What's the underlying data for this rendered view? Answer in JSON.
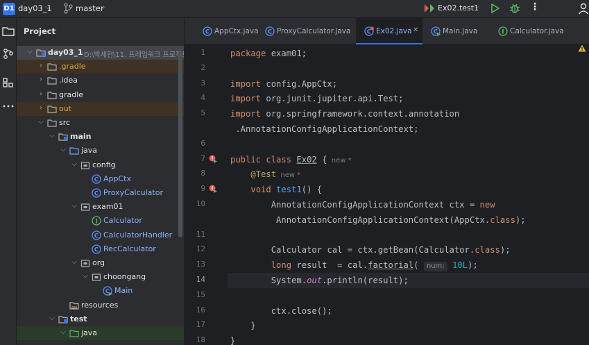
{
  "titlebar": {
    "project_badge": "D1",
    "project_name": "day03_1",
    "branch": "master",
    "run_config": "Ex02.test1",
    "more": "⋮"
  },
  "project_panel": {
    "title": "Project",
    "tree": [
      {
        "label": "day03_1",
        "extra": "D:\\박세현\\11. 프레임워크 프로젝트",
        "level": 0,
        "expanded": true,
        "icon": "module-folder-icon",
        "bold": true,
        "style": "sel"
      },
      {
        "label": ".gradle",
        "level": 1,
        "expanded": false,
        "icon": "folder-icon",
        "color": "orange",
        "style": "excl"
      },
      {
        "label": ".idea",
        "level": 1,
        "expanded": false,
        "icon": "folder-icon"
      },
      {
        "label": "gradle",
        "level": 1,
        "expanded": false,
        "icon": "folder-icon"
      },
      {
        "label": "out",
        "level": 1,
        "expanded": false,
        "icon": "folder-icon",
        "color": "orange",
        "style": "excl"
      },
      {
        "label": "src",
        "level": 1,
        "expanded": true,
        "icon": "folder-icon"
      },
      {
        "label": "main",
        "level": 2,
        "expanded": true,
        "icon": "module-folder-icon",
        "bold": true
      },
      {
        "label": "java",
        "level": 3,
        "expanded": true,
        "icon": "source-folder-icon"
      },
      {
        "label": "config",
        "level": 4,
        "expanded": true,
        "icon": "package-icon"
      },
      {
        "label": "AppCtx",
        "level": 5,
        "icon": "class-icon",
        "color": "blue"
      },
      {
        "label": "ProxyCalculator",
        "level": 5,
        "icon": "class-icon",
        "color": "blue"
      },
      {
        "label": "exam01",
        "level": 4,
        "expanded": true,
        "icon": "package-icon"
      },
      {
        "label": "Calculator",
        "level": 5,
        "icon": "interface-icon",
        "color": "blue"
      },
      {
        "label": "CalculatorHandler",
        "level": 5,
        "icon": "class-icon",
        "color": "blue"
      },
      {
        "label": "RecCalculator",
        "level": 5,
        "icon": "class-icon",
        "color": "blue"
      },
      {
        "label": "org",
        "level": 4,
        "expanded": true,
        "icon": "package-icon"
      },
      {
        "label": "choongang",
        "level": 5,
        "expanded": true,
        "icon": "package-icon"
      },
      {
        "label": "Main",
        "level": 6,
        "icon": "main-class-icon",
        "color": "blue"
      },
      {
        "label": "resources",
        "level": 3,
        "icon": "resources-folder-icon"
      },
      {
        "label": "test",
        "level": 2,
        "expanded": true,
        "icon": "module-folder-icon",
        "bold": true
      },
      {
        "label": "java",
        "level": 3,
        "expanded": true,
        "icon": "test-folder-icon",
        "style": "test-hl"
      }
    ]
  },
  "tabs": [
    {
      "label": "AppCtx.java",
      "icon": "class-icon"
    },
    {
      "label": "ProxyCalculator.java",
      "icon": "class-icon"
    },
    {
      "label": "Ex02.java",
      "icon": "test-class-icon",
      "active": true
    },
    {
      "label": "Main.java",
      "icon": "main-class-icon"
    },
    {
      "label": "Calculator.java",
      "icon": "interface-icon"
    }
  ],
  "editor": {
    "current_line": "14",
    "lines": [
      {
        "n": "1",
        "t": "package exam01;"
      },
      {
        "n": "2",
        "t": ""
      },
      {
        "n": "3",
        "t": "import config.AppCtx;"
      },
      {
        "n": "4",
        "t": "import org.junit.jupiter.api.Test;"
      },
      {
        "n": "5",
        "t": "import org.springframework.context.annotation"
      },
      {
        "n": "",
        "t": " .AnnotationConfigApplicationContext;"
      },
      {
        "n": "6",
        "t": ""
      },
      {
        "n": "7",
        "t": "public class Ex02 {",
        "hint": "new *"
      },
      {
        "n": "8",
        "t": "    @Test",
        "hint": "new *"
      },
      {
        "n": "9",
        "t": "    void test1() {"
      },
      {
        "n": "10",
        "t": "        AnnotationConfigApplicationContext ctx = new"
      },
      {
        "n": "",
        "t": "         AnnotationConfigApplicationContext(AppCtx.class);"
      },
      {
        "n": "11",
        "t": ""
      },
      {
        "n": "12",
        "t": "        Calculator cal = ctx.getBean(Calculator.class);"
      },
      {
        "n": "13",
        "t": "        long result  = cal.factorial( num: 10L);"
      },
      {
        "n": "14",
        "t": "        System.out.println(result);"
      },
      {
        "n": "15",
        "t": ""
      },
      {
        "n": "16",
        "t": "        ctx.close();"
      },
      {
        "n": "17",
        "t": "    }"
      },
      {
        "n": "18",
        "t": "}"
      }
    ]
  },
  "colors": {
    "accent": "#3574f0",
    "keyword": "#cf8e6d",
    "annotation": "#b3ae60",
    "function": "#56a8f5",
    "number": "#2aacb8",
    "field": "#c77dbb",
    "excluded": "#d9a343"
  }
}
